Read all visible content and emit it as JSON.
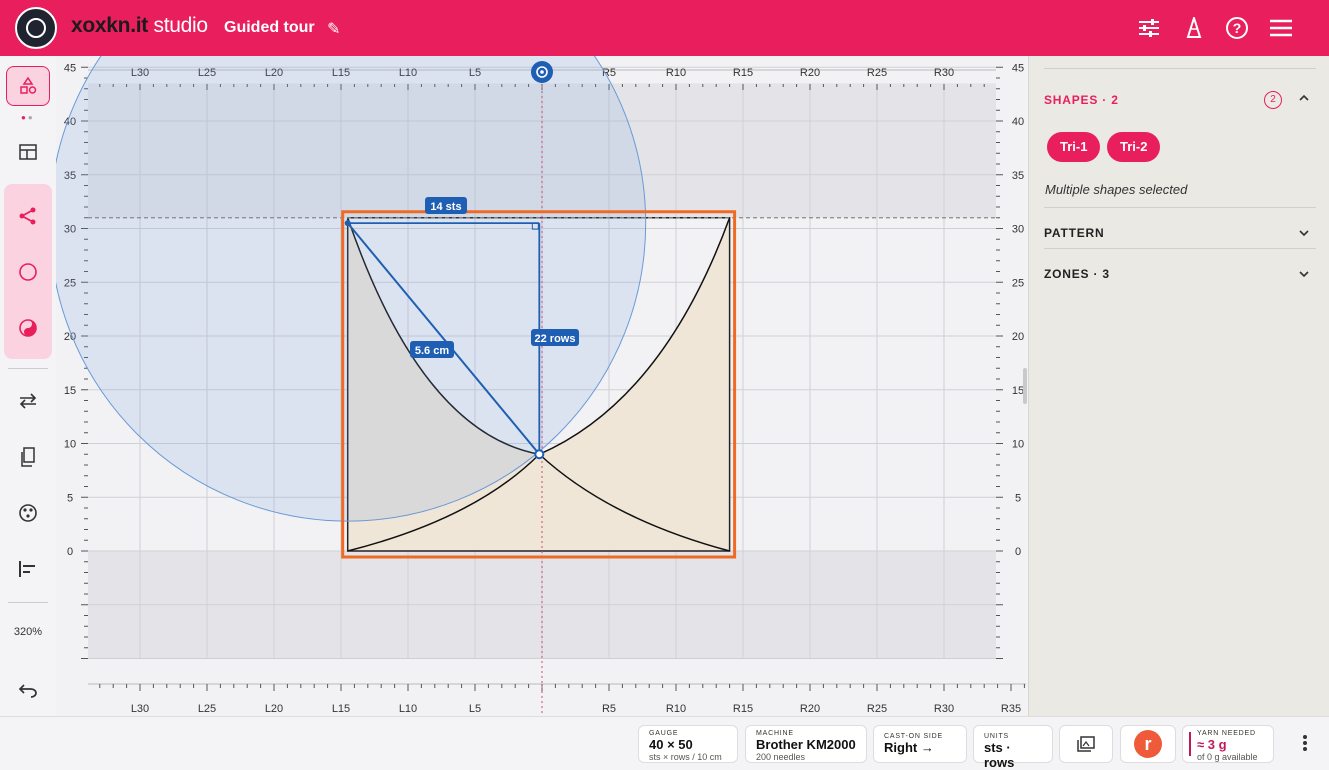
{
  "app": {
    "brand_bold": "xoxkn.it",
    "brand_light": "studio",
    "tour_title": "Guided tour"
  },
  "colors": {
    "accent": "#e91e5d",
    "selection": "#f06a24",
    "measure": "#1e5fb3",
    "fill": "#efe6d8"
  },
  "toolbar_icons": [
    "sliders-icon",
    "cone-icon",
    "help-icon",
    "menu-icon"
  ],
  "leftbar": {
    "zoom": "320%"
  },
  "ruler": {
    "top_labels": [
      "L30",
      "L25",
      "L20",
      "L15",
      "L10",
      "L5",
      "",
      "R5",
      "R10",
      "R15",
      "R20",
      "R25",
      "R30"
    ],
    "bottom_labels": [
      "L30",
      "L25",
      "L20",
      "L15",
      "L10",
      "L5",
      "",
      "R5",
      "R10",
      "R15",
      "R20",
      "R25",
      "R30",
      "R35"
    ],
    "row_labels": [
      "45",
      "40",
      "35",
      "30",
      "25",
      "20",
      "15",
      "10",
      "5",
      "0"
    ]
  },
  "measure": {
    "sts": "14 sts",
    "rows": "22 rows",
    "diag": "5.6 cm"
  },
  "panel": {
    "shapes_title": "SHAPES · 2",
    "shapes_count": "2",
    "chips": [
      "Tri-1",
      "Tri-2"
    ],
    "selection_note": "Multiple shapes selected",
    "pattern_title": "PATTERN",
    "zones_title": "ZONES · 3"
  },
  "bottom": {
    "gauge": {
      "label": "GAUGE",
      "value": "40 × 50",
      "sub": "sts × rows / 10 cm"
    },
    "machine": {
      "label": "MACHINE",
      "value": "Brother KM2000",
      "sub": "200 needles"
    },
    "caston": {
      "label": "CAST-ON SIDE",
      "value": "Right →"
    },
    "units": {
      "label": "UNITS",
      "value": "sts · rows"
    },
    "avatar": "r",
    "yarn": {
      "label": "YARN NEEDED",
      "value": "≈ 3 g",
      "sub": "of 0 g available"
    }
  }
}
